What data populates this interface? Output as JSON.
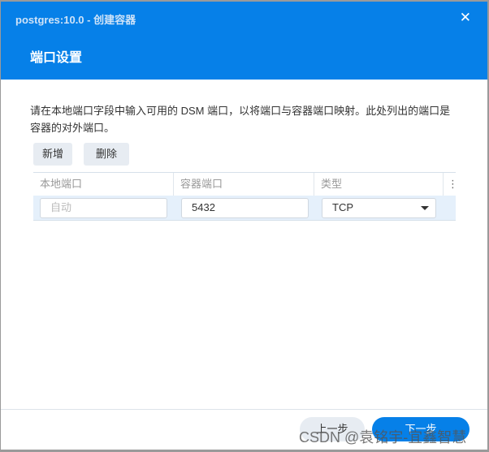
{
  "window": {
    "title": "postgres:10.0 - 创建容器",
    "step_title": "端口设置"
  },
  "description": "请在本地端口字段中输入可用的 DSM 端口，以将端口与容器端口映射。此处列出的端口是容器的对外端口。",
  "toolbar": {
    "add_label": "新增",
    "delete_label": "删除"
  },
  "table": {
    "columns": [
      "本地端口",
      "容器端口",
      "类型"
    ],
    "rows": [
      {
        "local_port_placeholder": "自动",
        "container_port": "5432",
        "type": "TCP"
      }
    ]
  },
  "footer": {
    "back_label": "上一步",
    "next_label": "下一步"
  },
  "watermark": "CSDN @袁铭宇-宜鑫智慧"
}
